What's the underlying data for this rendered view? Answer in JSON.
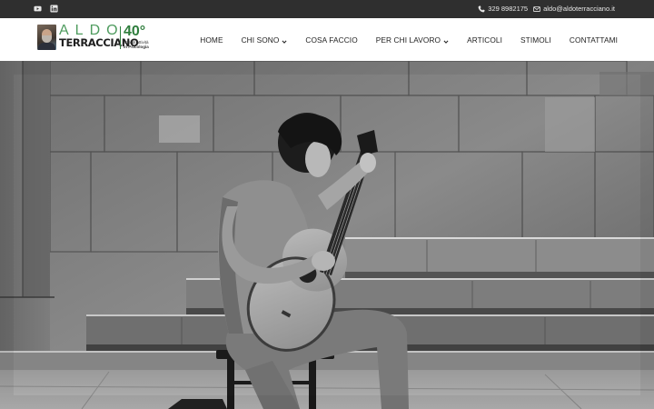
{
  "topbar": {
    "social": [
      {
        "icon": "youtube-icon"
      },
      {
        "icon": "linkedin-icon"
      }
    ],
    "phone": "329 8982175",
    "email": "aldo@aldoterracciano.it"
  },
  "logo": {
    "first_name": "ALDO",
    "last_name": "TERRACCIANO",
    "years": "40°",
    "tagline_line1": "anni di attività",
    "tagline_line2": "in Psicologia",
    "accent_color": "#2e7d3c"
  },
  "nav": {
    "items": [
      {
        "label": "HOME",
        "dropdown": false
      },
      {
        "label": "CHI SONO",
        "dropdown": true
      },
      {
        "label": "COSA FACCIO",
        "dropdown": false
      },
      {
        "label": "PER CHI LAVORO",
        "dropdown": true
      },
      {
        "label": "ARTICOLI",
        "dropdown": false
      },
      {
        "label": "STIMOLI",
        "dropdown": false
      },
      {
        "label": "CONTATTAMI",
        "dropdown": false
      }
    ]
  },
  "hero": {
    "description": ""
  }
}
